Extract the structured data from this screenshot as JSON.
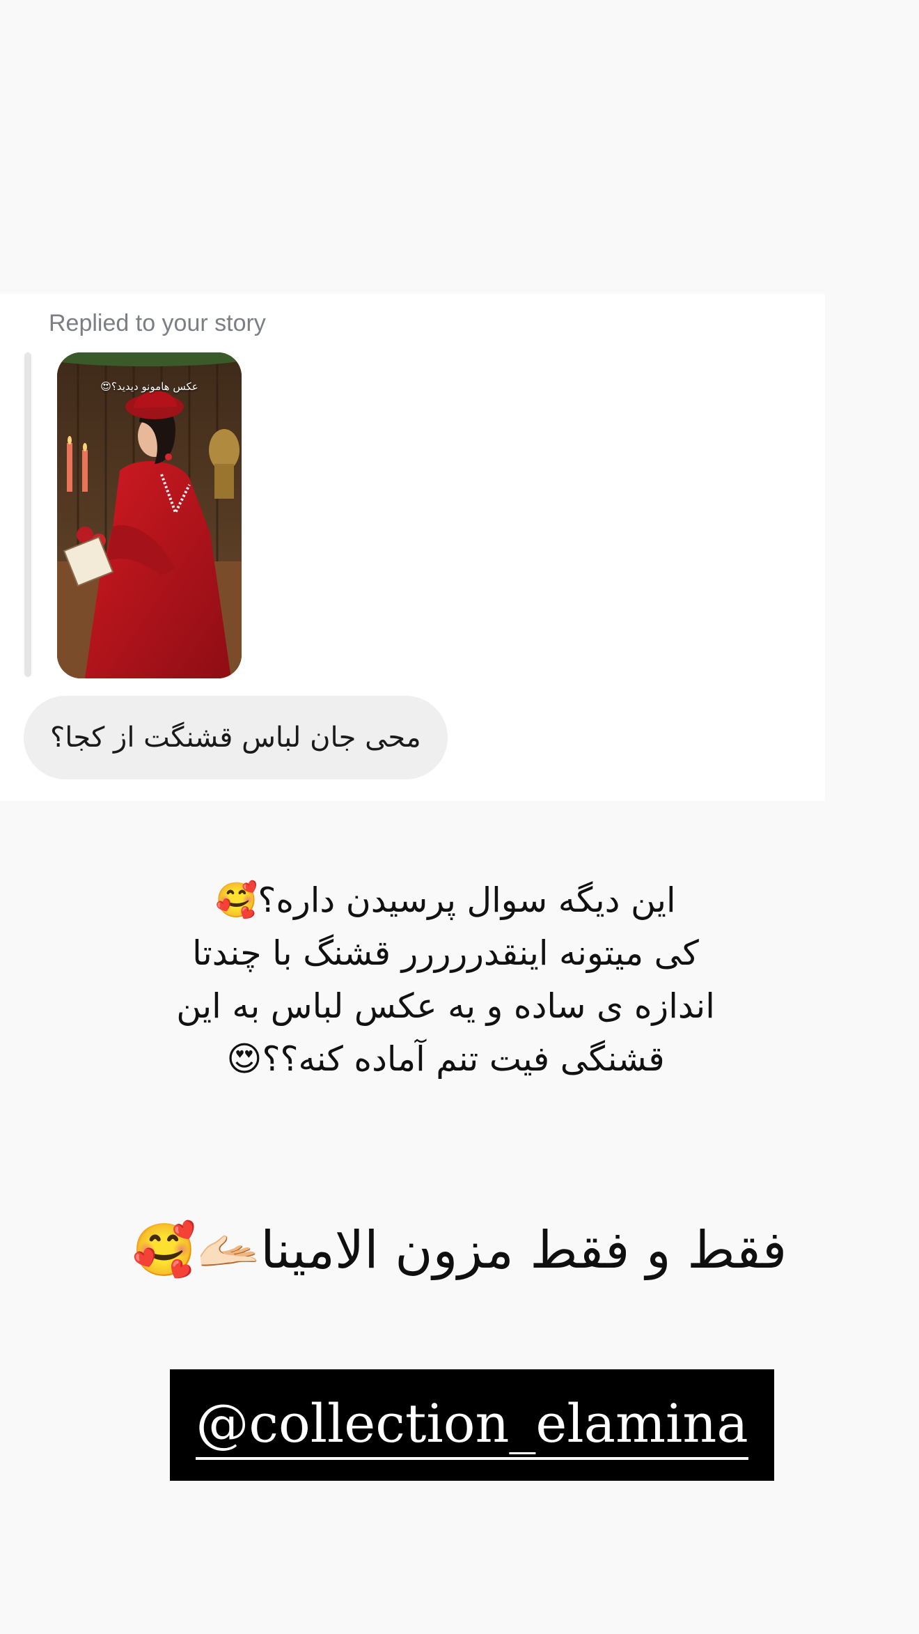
{
  "reply": {
    "header": "Replied to your story",
    "story_caption": "عکس هامونو دیدید؟😍",
    "message": "محی جان لباس قشنگت از کجا؟"
  },
  "story": {
    "text_lines": [
      "این دیگه سوال پرسیدن داره؟🥰",
      "کی میتونه اینقدررررر قشنگ با چندتا",
      "اندازه ی ساده و یه عکس لباس به این",
      "قشنگی فیت تنم آماده کنه؟؟😍"
    ],
    "tagline": "فقط و فقط مزون الامینا🫴🏻🥰",
    "mention": "@collection_elamina"
  },
  "colors": {
    "background": "#f9f9f9",
    "card": "#ffffff",
    "bubble": "#efefef",
    "header_text": "#7b7f85",
    "sticker": "#000000",
    "dress_red": "#b3121b"
  }
}
